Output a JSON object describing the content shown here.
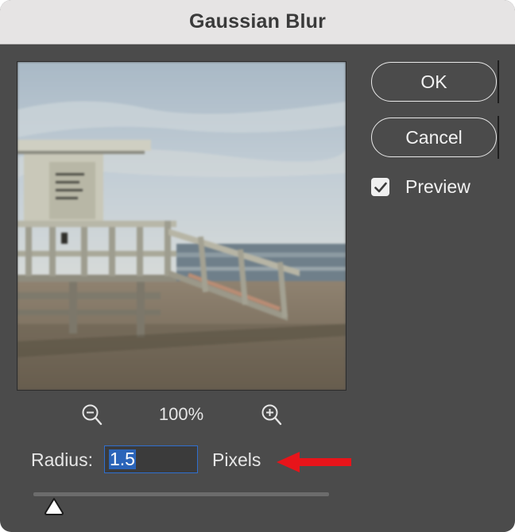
{
  "dialog": {
    "title": "Gaussian Blur",
    "ok_label": "OK",
    "cancel_label": "Cancel",
    "preview_label": "Preview",
    "preview_checked": true
  },
  "zoom": {
    "value": "100%",
    "zoom_out_icon": "zoom-out-icon",
    "zoom_in_icon": "zoom-in-icon"
  },
  "radius": {
    "label": "Radius:",
    "value": "1.5",
    "unit": "Pixels",
    "slider_level_percent": 6
  },
  "colors": {
    "dialog_bg": "#4b4b4b",
    "titlebar_bg": "#e6e4e4",
    "selection": "#2a64b9",
    "annotation_arrow": "#e8141a"
  }
}
